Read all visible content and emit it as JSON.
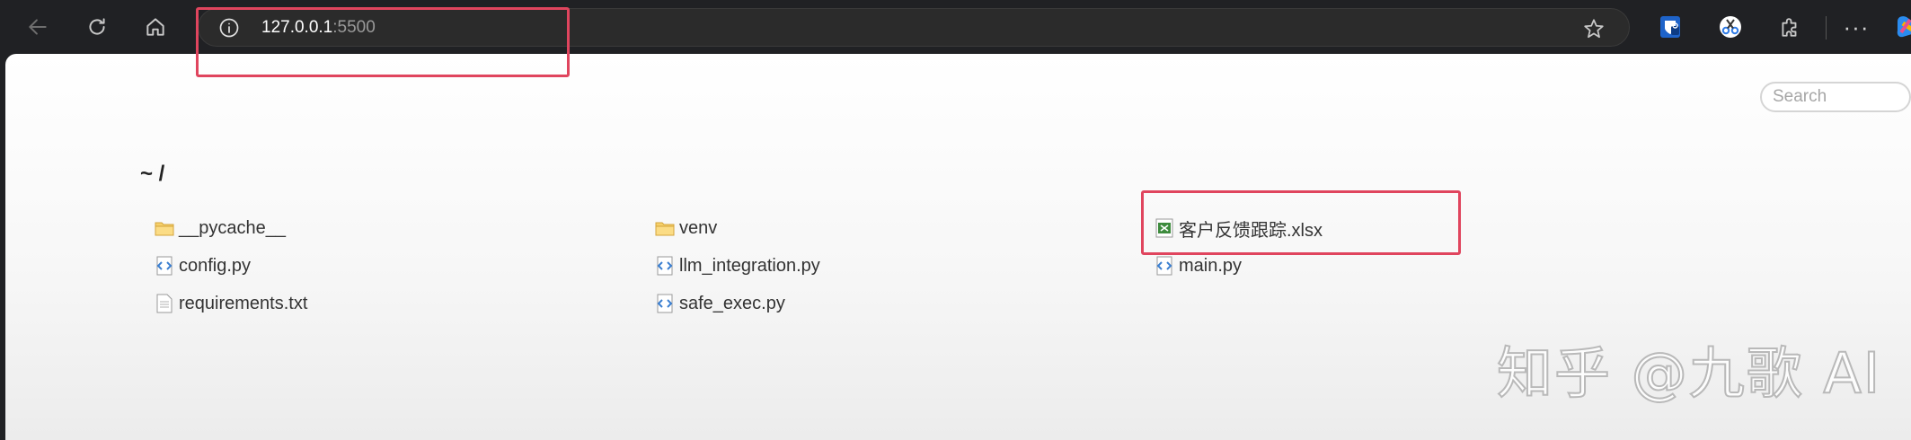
{
  "browser": {
    "url_host": "127.0.0.1",
    "url_port": ":5500",
    "icons": {
      "back": "arrow-left-icon",
      "reload": "reload-icon",
      "home": "home-icon",
      "info": "info-icon",
      "favorite": "star-icon",
      "extension_1": "shield-extension-icon",
      "extension_2": "scissors-extension-icon",
      "extensions": "puzzle-icon",
      "menu": "more-icon",
      "copilot": "copilot-icon"
    },
    "menu_label": "···"
  },
  "page": {
    "search_placeholder": "Search",
    "breadcrumb": "~ /",
    "files": [
      {
        "name": "__pycache__",
        "type": "folder"
      },
      {
        "name": "venv",
        "type": "folder"
      },
      {
        "name": "客户反馈跟踪.xlsx",
        "type": "excel"
      },
      {
        "name": "config.py",
        "type": "python"
      },
      {
        "name": "llm_integration.py",
        "type": "python"
      },
      {
        "name": "main.py",
        "type": "python"
      },
      {
        "name": "requirements.txt",
        "type": "text"
      },
      {
        "name": "safe_exec.py",
        "type": "python"
      }
    ]
  },
  "watermark": "知乎 @九歌 AI",
  "colors": {
    "highlight": "#e0455e",
    "chrome_bg": "#202124",
    "page_bg": "#ffffff"
  }
}
